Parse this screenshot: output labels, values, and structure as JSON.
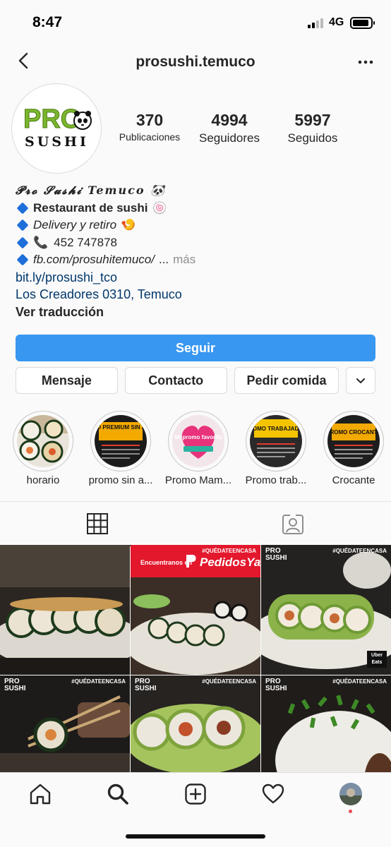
{
  "status_bar": {
    "time": "8:47",
    "network": "4G"
  },
  "header": {
    "username": "prosushi.temuco",
    "back_icon": "chevron-left-icon",
    "more_icon": "ellipsis-icon"
  },
  "profile": {
    "logo_text_top": "PRO",
    "logo_text_bottom": "SUSHI",
    "stats": [
      {
        "value": "370",
        "label": "Publicaciones"
      },
      {
        "value": "4994",
        "label": "Seguidores"
      },
      {
        "value": "5997",
        "label": "Seguidos"
      }
    ]
  },
  "bio": {
    "name": "𝓟𝓻𝓸 𝓢𝓾𝓼𝓱𝓲 Temuco 🐼",
    "name_text": "Pro Sushi Temuco",
    "line1": "Restaurant de sushi",
    "line1_emoji": "🍥",
    "line2": "Delivery y retiro",
    "line2_emoji": "🍤",
    "line3": "452 747878",
    "line3_emoji": "📞",
    "line4": "fb.com/prosuhitemuco/",
    "line4_ellipsis": "...",
    "line4_more": "más",
    "link": "bit.ly/prosushi_tco",
    "address": "Los Creadores 0310, Temuco",
    "translate": "Ver traducción"
  },
  "buttons": {
    "follow": "Seguir",
    "message": "Mensaje",
    "contact": "Contacto",
    "order": "Pedir comida"
  },
  "highlights": [
    {
      "label": "horario"
    },
    {
      "label": "promo sin a..."
    },
    {
      "label": "Promo Mam..."
    },
    {
      "label": "Promo trab..."
    },
    {
      "label": "Crocante"
    }
  ],
  "highlight_covers": {
    "h2_title": "PROMO PREMIUM SIN ARROZ",
    "h3_title": "Mi promo favorita",
    "h4_title": "PROMO TRABAJADOR",
    "h5_title": "PROMO CROCANTE"
  },
  "grid": {
    "hashtag": "#QUÉDATEENCASA",
    "pedidos_found": "Encuentranos en",
    "pedidos_brand": "PedidosYa",
    "uber_label": "Uber Eats",
    "pro_label": "PRO SUSHI"
  },
  "colors": {
    "follow_button": "#3897f0",
    "link": "#00376b",
    "pedidos_red": "#e3182d",
    "logo_green": "#7bb62d"
  }
}
